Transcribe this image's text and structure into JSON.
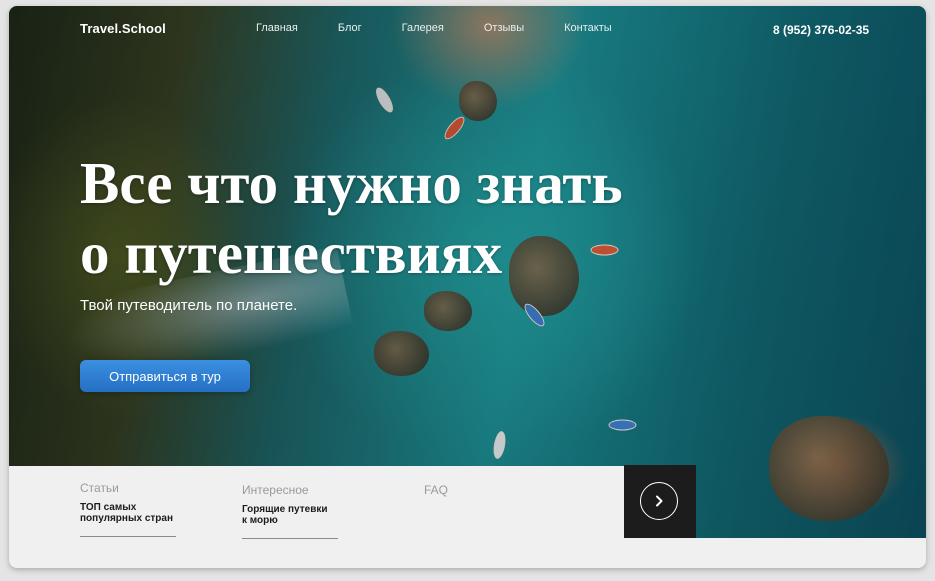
{
  "header": {
    "logo": "Travel.School",
    "nav": [
      "Главная",
      "Блог",
      "Галерея",
      "Отзывы",
      "Контакты"
    ],
    "phone": "8 (952) 376-02-35"
  },
  "hero": {
    "title_line1": "Все что нужно знать",
    "title_line2": "о путешествиях",
    "subtitle": "Твой путеводитель по планете.",
    "cta_label": "Отправиться в тур"
  },
  "cards": [
    {
      "category": "Статьи",
      "desc_line1": "ТОП самых",
      "desc_line2": "популярных стран"
    },
    {
      "category": "Интересное",
      "desc_line1": "Горящие путевки",
      "desc_line2": "к морю"
    },
    {
      "category": "FAQ",
      "desc_line1": "",
      "desc_line2": ""
    }
  ],
  "next_button": {
    "icon": "chevron-right-icon"
  },
  "colors": {
    "cta": "#2f80d6",
    "next_bg": "#1c1c1c",
    "panel_bg": "#f0f0f0"
  }
}
